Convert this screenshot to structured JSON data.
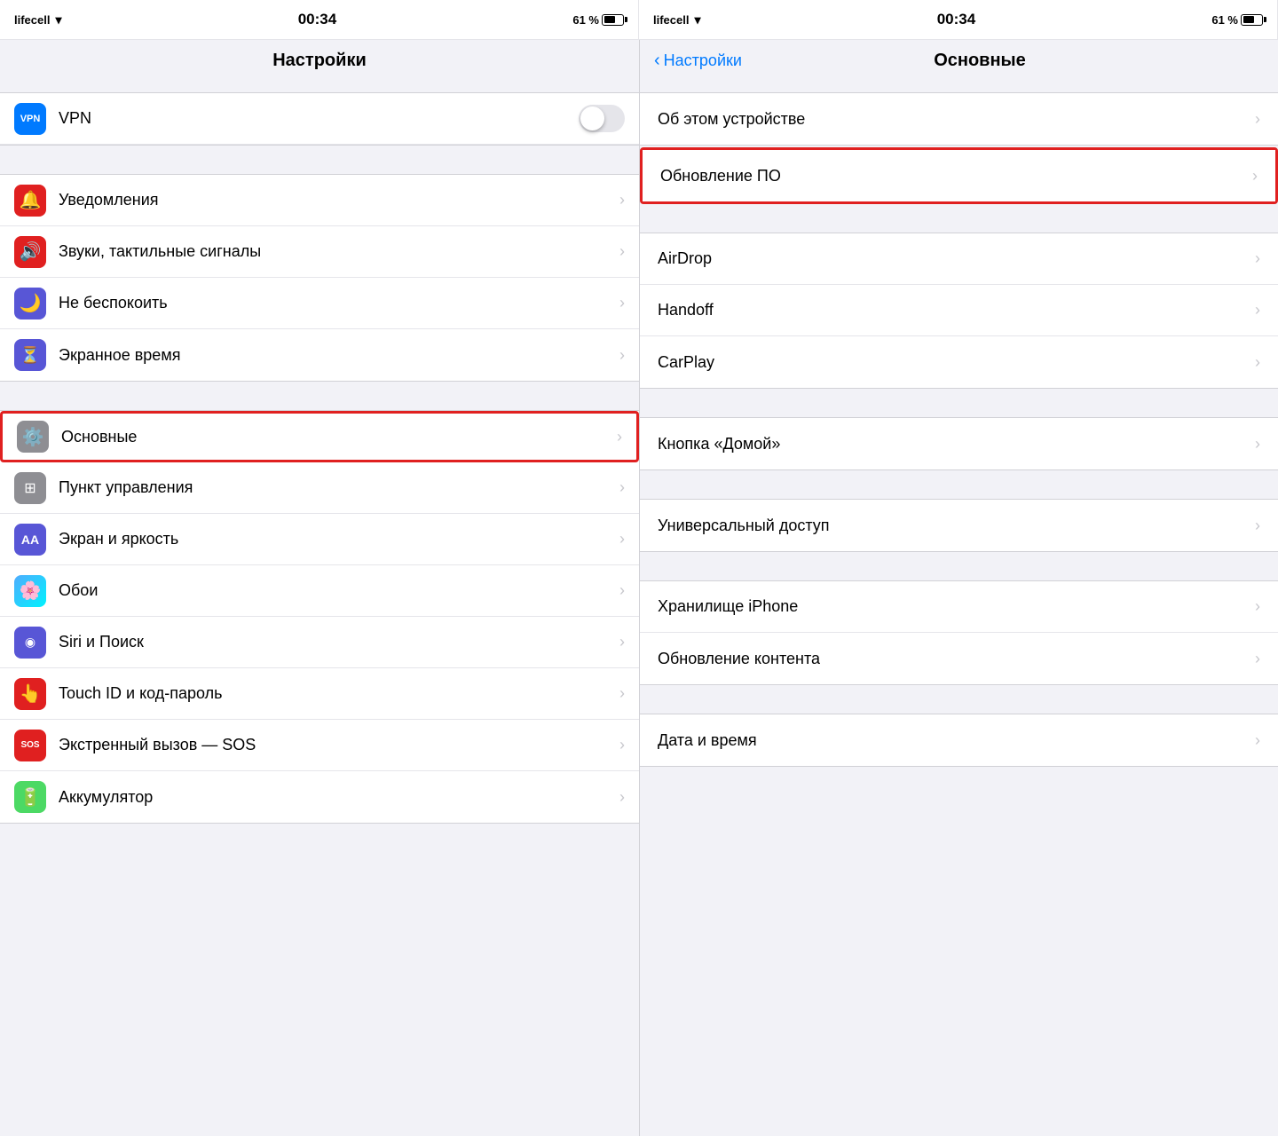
{
  "left": {
    "statusBar": {
      "carrier": "lifecell",
      "wifi": "WiFi",
      "time": "00:34",
      "battery": "61 %"
    },
    "title": "Настройки",
    "sections": [
      {
        "items": [
          {
            "id": "vpn",
            "label": "VPN",
            "iconColor": "#007aff",
            "iconChar": "VPN",
            "hasToggle": true,
            "hasChevron": false
          }
        ]
      },
      {
        "items": [
          {
            "id": "notifications",
            "label": "Уведомления",
            "iconColor": "#e02020",
            "iconChar": "🔔",
            "hasChevron": true
          },
          {
            "id": "sounds",
            "label": "Звуки, тактильные сигналы",
            "iconColor": "#e02020",
            "iconChar": "🔊",
            "hasChevron": true
          },
          {
            "id": "donotdisturb",
            "label": "Не беспокоить",
            "iconColor": "#5856d6",
            "iconChar": "🌙",
            "hasChevron": true
          },
          {
            "id": "screentime",
            "label": "Экранное время",
            "iconColor": "#5856d6",
            "iconChar": "⏳",
            "hasChevron": true
          }
        ]
      },
      {
        "items": [
          {
            "id": "general",
            "label": "Основные",
            "iconColor": "#8e8e93",
            "iconChar": "⚙️",
            "hasChevron": true,
            "highlighted": true
          },
          {
            "id": "controlcenter",
            "label": "Пункт управления",
            "iconColor": "#8e8e93",
            "iconChar": "⊞",
            "hasChevron": true
          },
          {
            "id": "display",
            "label": "Экран и яркость",
            "iconColor": "#5856d6",
            "iconChar": "AA",
            "hasChevron": true
          },
          {
            "id": "wallpaper",
            "label": "Обои",
            "iconColor": "#4facfe",
            "iconChar": "🌸",
            "hasChevron": true
          },
          {
            "id": "siri",
            "label": "Siri и Поиск",
            "iconColor": "#5856d6",
            "iconChar": "◉",
            "hasChevron": true
          },
          {
            "id": "touchid",
            "label": "Touch ID и код-пароль",
            "iconColor": "#e02020",
            "iconChar": "👆",
            "hasChevron": true
          },
          {
            "id": "sos",
            "label": "Экстренный вызов — SOS",
            "iconColor": "#e02020",
            "iconChar": "SOS",
            "hasChevron": true
          },
          {
            "id": "battery",
            "label": "Аккумулятор",
            "iconColor": "#4cd964",
            "iconChar": "🔋",
            "hasChevron": true
          }
        ]
      }
    ]
  },
  "right": {
    "statusBar": {
      "carrier": "lifecell",
      "wifi": "WiFi",
      "time": "00:34",
      "battery": "61 %"
    },
    "backLabel": "Настройки",
    "title": "Основные",
    "sections": [
      {
        "items": [
          {
            "id": "about",
            "label": "Об этом устройстве",
            "hasChevron": true
          }
        ]
      },
      {
        "items": [
          {
            "id": "software",
            "label": "Обновление ПО",
            "hasChevron": true,
            "highlighted": true
          }
        ]
      },
      {
        "items": [
          {
            "id": "airdrop",
            "label": "AirDrop",
            "hasChevron": true
          },
          {
            "id": "handoff",
            "label": "Handoff",
            "hasChevron": true
          },
          {
            "id": "carplay",
            "label": "CarPlay",
            "hasChevron": true
          }
        ]
      },
      {
        "items": [
          {
            "id": "homebutton",
            "label": "Кнопка «Домой»",
            "hasChevron": true
          }
        ]
      },
      {
        "items": [
          {
            "id": "accessibility",
            "label": "Универсальный доступ",
            "hasChevron": true
          }
        ]
      },
      {
        "items": [
          {
            "id": "storage",
            "label": "Хранилище iPhone",
            "hasChevron": true
          },
          {
            "id": "bgrefresh",
            "label": "Обновление контента",
            "hasChevron": true
          }
        ]
      },
      {
        "items": [
          {
            "id": "datetime",
            "label": "Дата и время",
            "hasChevron": true
          }
        ]
      }
    ]
  }
}
